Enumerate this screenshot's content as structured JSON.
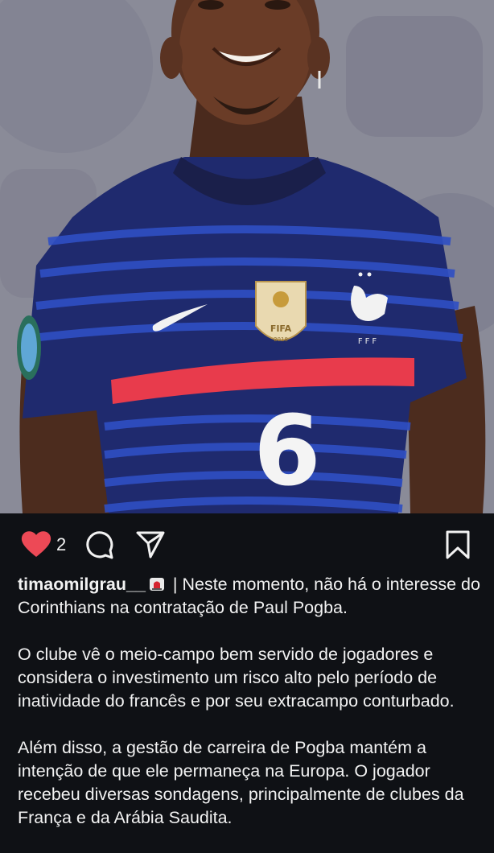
{
  "post": {
    "image_alt": "Player in France national team jersey number 6",
    "jersey_number": "6",
    "badge_text": "FIFA",
    "badge_year": "2018",
    "crest_text": "FFF"
  },
  "actions": {
    "like_count": "2",
    "icons": [
      "heart-icon",
      "comment-icon",
      "share-icon",
      "bookmark-icon"
    ],
    "like_color": "#ed4956"
  },
  "caption": {
    "username": "timaomilgrau__",
    "emoji": "rotating-light",
    "line1": " | Neste momento, não há o interesse do Corinthians na contratação de Paul Pogba.",
    "paragraph2": "O clube vê o meio-campo bem servido de jogadores e considera o investimento um risco alto pelo período de inatividade do francês e por seu extracampo conturbado.",
    "paragraph3": "Além disso, a gestão de carreira de Pogba mantém a intenção de que ele permaneça na Europa. O jogador recebeu diversas sondagens, principalmente de clubes da França e da Arábia Saudita."
  }
}
